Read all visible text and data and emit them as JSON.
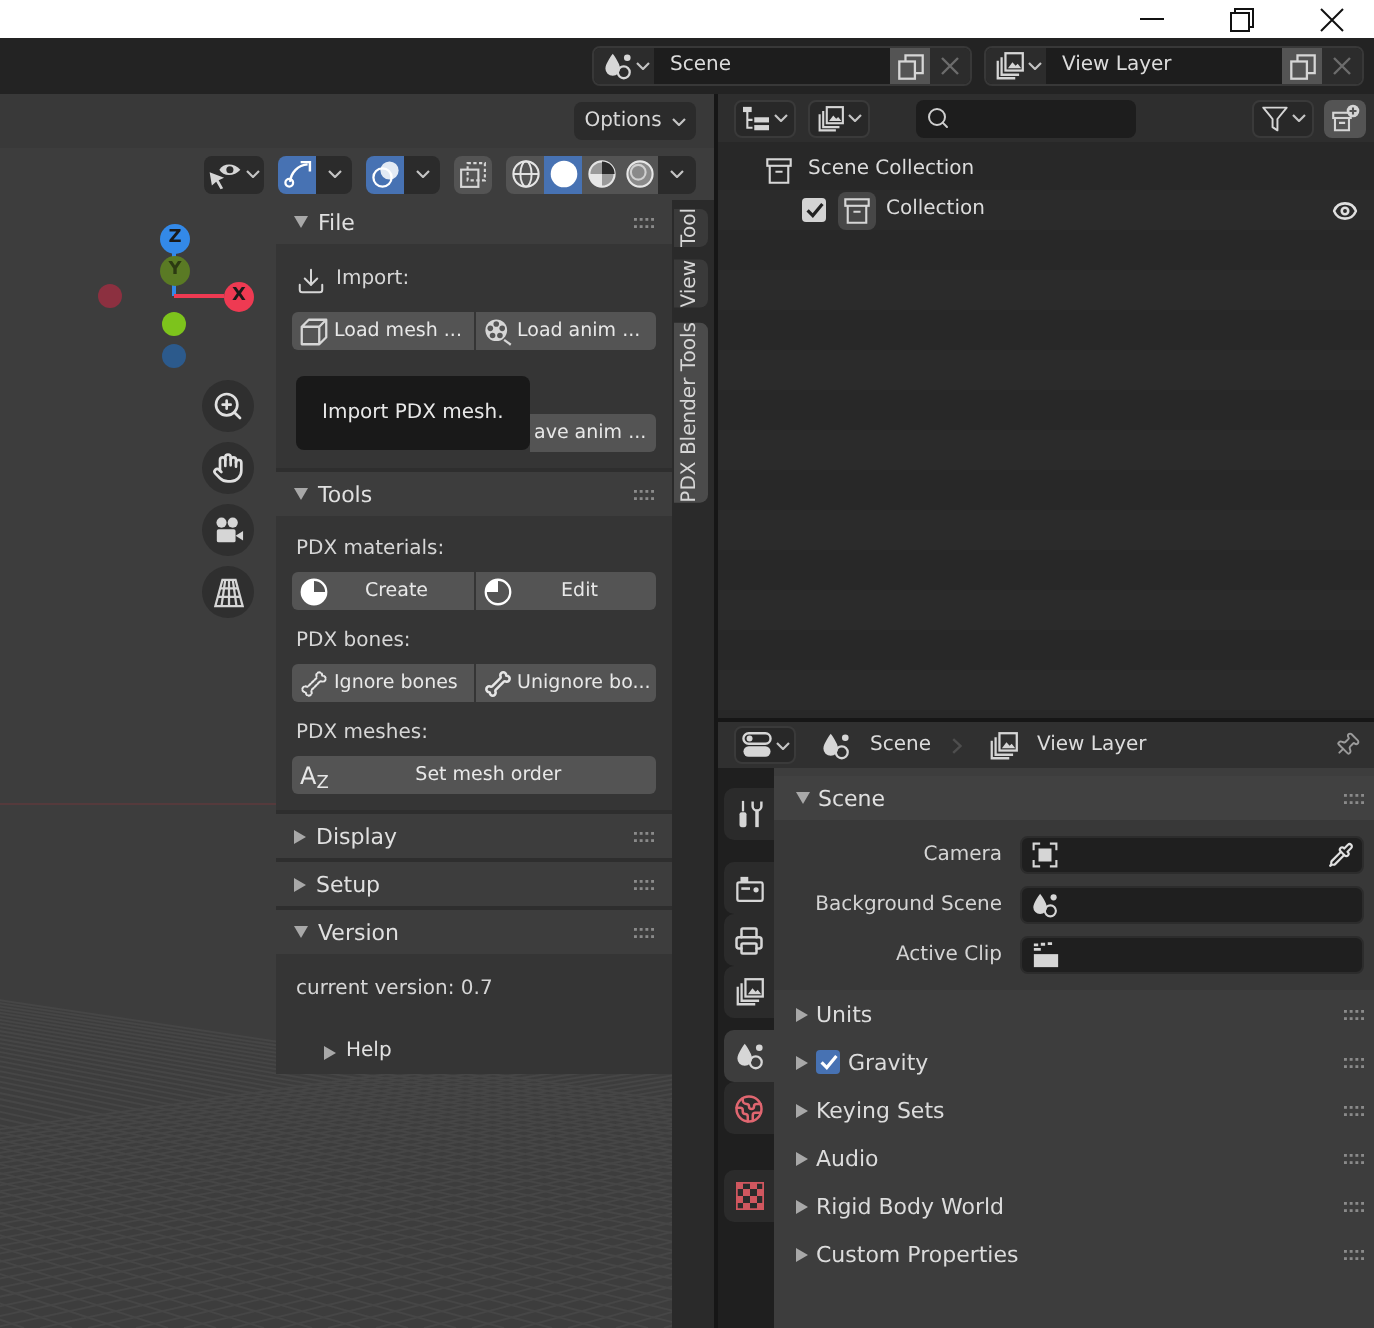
{
  "top_bar": {
    "scene": "Scene",
    "view_layer": "View Layer"
  },
  "viewport": {
    "options_button": "Options",
    "toggles": [
      {
        "kind": "gizmo",
        "on": true
      },
      {
        "kind": "overlay",
        "on": true
      },
      {
        "kind": "xray",
        "on": false
      }
    ],
    "shading_modes": [
      {
        "kind": "wireframe",
        "selected": false
      },
      {
        "kind": "solid",
        "selected": true
      },
      {
        "kind": "material",
        "selected": false
      },
      {
        "kind": "rendered",
        "selected": false
      }
    ],
    "axis_gizmo": [
      {
        "kind": "z",
        "label": "Z",
        "color": "#3389e8"
      },
      {
        "kind": "y",
        "label": "Y",
        "color": "#5a7a24"
      },
      {
        "kind": "negx",
        "color": "#8c3040"
      },
      {
        "kind": "x",
        "label": "X",
        "color": "#ee3a52"
      },
      {
        "kind": "negy",
        "color": "#7dc31c"
      },
      {
        "kind": "negz",
        "color": "#2c5a8c"
      }
    ]
  },
  "sidebar": {
    "tabs": [
      {
        "label": "Tool",
        "selected": false
      },
      {
        "label": "View",
        "selected": false
      },
      {
        "label": "PDX Blender Tools",
        "selected": true
      }
    ],
    "file": {
      "title": "File",
      "expanded": true,
      "import_label": "Import:",
      "import_buttons": [
        {
          "kind": "mesh",
          "label": "Load mesh ..."
        },
        {
          "kind": "anim",
          "label": "Load anim ..."
        }
      ],
      "export_visible": "ave anim ...",
      "tooltip": "Import PDX mesh."
    },
    "tools": {
      "title": "Tools",
      "expanded": true,
      "groups": [
        {
          "label": "PDX materials:",
          "buttons": [
            {
              "kind": "material_create",
              "label": "Create"
            },
            {
              "kind": "material_edit",
              "label": "Edit"
            }
          ]
        },
        {
          "label": "PDX bones:",
          "buttons": [
            {
              "kind": "bone_ignore",
              "label": "Ignore bones"
            },
            {
              "kind": "bone_unignore",
              "label": "Unignore bo..."
            }
          ]
        },
        {
          "label": "PDX meshes:",
          "buttons": [
            {
              "kind": "sort",
              "label": "Set mesh order",
              "icon_text": "A$_{Z}$"
            }
          ]
        }
      ]
    },
    "panels": [
      {
        "title": "Display",
        "expanded": false
      },
      {
        "title": "Setup",
        "expanded": false
      },
      {
        "title": "Version",
        "expanded": true,
        "text": "current version: 0.7",
        "subpanels": [
          {
            "title": "Help",
            "expanded": false
          }
        ]
      }
    ]
  },
  "outliner": {
    "tree": [
      {
        "label": "Scene Collection",
        "active": false,
        "children": [
          {
            "label": "Collection",
            "active": true,
            "checked": true,
            "visible": true
          }
        ]
      }
    ]
  },
  "properties": {
    "breadcrumb": [
      {
        "kind": "scene",
        "label": "Scene"
      },
      {
        "kind": "view_layer",
        "label": "View Layer"
      }
    ],
    "tab_groups": [
      [
        {
          "kind": "tool",
          "selected": false
        }
      ],
      [
        {
          "kind": "render",
          "selected": false
        },
        {
          "kind": "output",
          "selected": false
        },
        {
          "kind": "view_layer",
          "selected": false
        }
      ],
      [
        {
          "kind": "scene",
          "selected": true
        },
        {
          "kind": "world",
          "selected": false
        }
      ],
      [
        {
          "kind": "texture",
          "selected": false
        }
      ]
    ],
    "scene_panel": {
      "title": "Scene",
      "expanded": true,
      "fields": [
        {
          "kind": "camera",
          "label": "Camera"
        },
        {
          "kind": "scene",
          "label": "Background Scene"
        },
        {
          "kind": "clip",
          "label": "Active Clip"
        }
      ]
    },
    "subpanels": [
      {
        "title": "Units",
        "expanded": false
      },
      {
        "title": "Gravity",
        "expanded": false,
        "checked": true
      },
      {
        "title": "Keying Sets",
        "expanded": false
      },
      {
        "title": "Audio",
        "expanded": false
      },
      {
        "title": "Rigid Body World",
        "expanded": false
      },
      {
        "title": "Custom Properties",
        "expanded": false
      }
    ]
  }
}
